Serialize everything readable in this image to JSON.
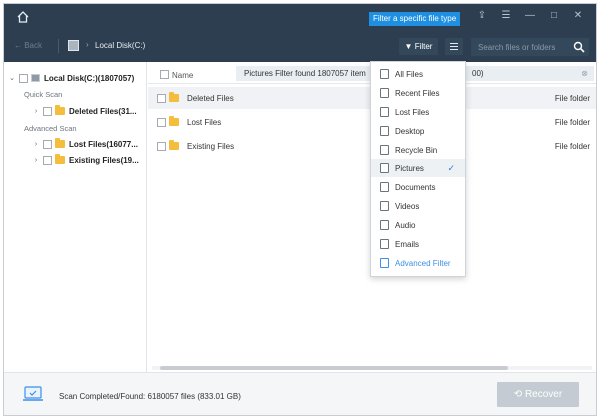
{
  "titlebar": {
    "filter_tip": "Filter a specific file type",
    "icons": [
      "home-icon",
      "share-icon",
      "menu-icon",
      "minimize-icon",
      "maximize-icon",
      "close-icon"
    ]
  },
  "navbar": {
    "back_label": "← Back",
    "breadcrumb": "Local Disk(C:)",
    "filter_label": "Filter",
    "search_placeholder": "Search files or folders"
  },
  "tree": {
    "root_label": "Local Disk(C:)(1807057)",
    "quick_scan_label": "Quick Scan",
    "advanced_scan_label": "Advanced Scan",
    "quick_items": [
      {
        "label": "Deleted Files(31..."
      }
    ],
    "advanced_items": [
      {
        "label": "Lost Files(16077..."
      },
      {
        "label": "Existing Files(19..."
      }
    ]
  },
  "list": {
    "header_name": "Name",
    "notice": "Pictures Filter found 1807057 item",
    "notice_tail": "00)",
    "rows": [
      {
        "name": "Deleted Files",
        "type": "File folder"
      },
      {
        "name": "Lost Files",
        "type": "File folder"
      },
      {
        "name": "Existing Files",
        "type": "File folder"
      }
    ]
  },
  "dropdown": {
    "items": [
      {
        "label": "All Files",
        "icon": "all-files-icon"
      },
      {
        "label": "Recent Files",
        "icon": "recent-files-icon"
      },
      {
        "label": "Lost Files",
        "icon": "lost-files-icon"
      },
      {
        "label": "Desktop",
        "icon": "desktop-icon"
      },
      {
        "label": "Recycle Bin",
        "icon": "recycle-bin-icon"
      },
      {
        "label": "Pictures",
        "icon": "pictures-icon",
        "selected": true
      },
      {
        "label": "Documents",
        "icon": "documents-icon"
      },
      {
        "label": "Videos",
        "icon": "videos-icon"
      },
      {
        "label": "Audio",
        "icon": "audio-icon"
      },
      {
        "label": "Emails",
        "icon": "emails-icon"
      },
      {
        "label": "Advanced Filter",
        "icon": "advanced-filter-icon"
      }
    ],
    "check_mark": "✓"
  },
  "bottombar": {
    "status": "Scan Completed/Found: 6180057 files (833.01 GB)",
    "recover_label": "Recover"
  },
  "colors": {
    "titlebar_bg": "#2d3e50",
    "accent": "#1e8fe1",
    "folder": "#f4bd3c",
    "recover_disabled": "#c4cbd3"
  }
}
